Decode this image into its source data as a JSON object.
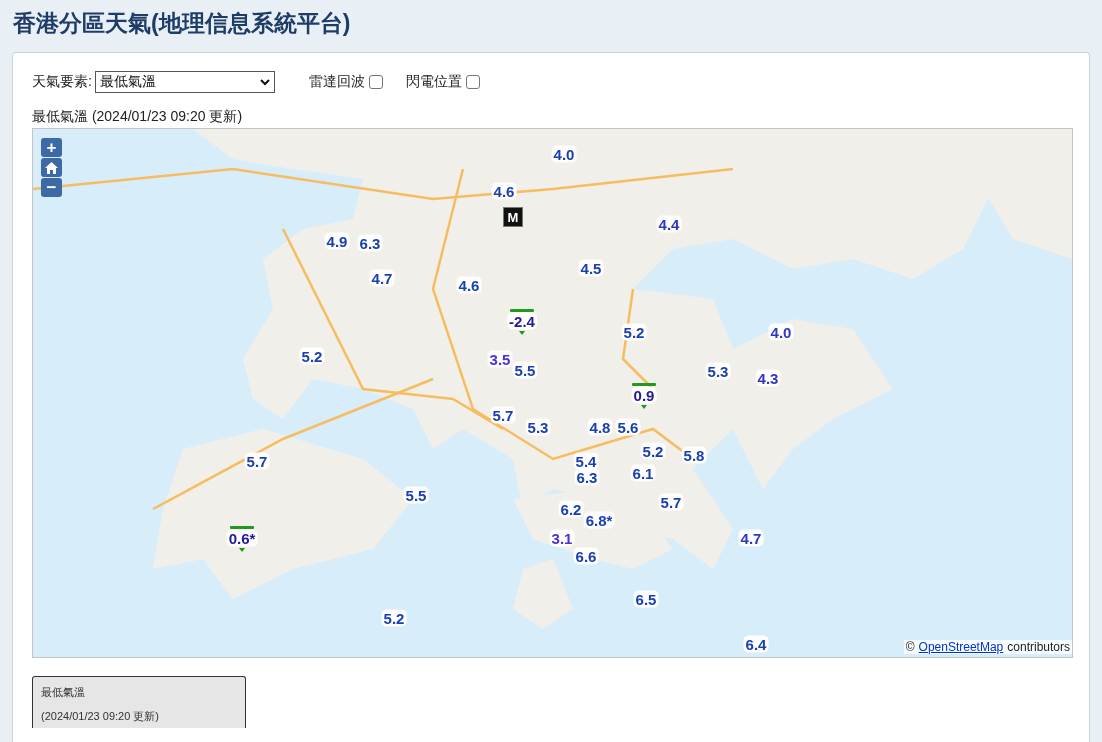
{
  "title": "香港分區天氣(地理信息系統平台)",
  "controls": {
    "element_label": "天氣要素:",
    "element_value": "最低氣溫",
    "checkboxes": [
      {
        "label": "雷達回波",
        "checked": false
      },
      {
        "label": "閃電位置",
        "checked": false
      }
    ]
  },
  "map_heading": "最低氣溫 (2024/01/23 09:20 更新)",
  "map": {
    "zoom_in": "+",
    "zoom_out": "−",
    "marker": "M",
    "stations": [
      {
        "value": "4.0",
        "color": "#1a3fb0",
        "lowest": false
      },
      {
        "value": "4.6",
        "color": "#1a3fb0",
        "lowest": false
      },
      {
        "value": "4.4",
        "color": "#2f35c4",
        "lowest": false
      },
      {
        "value": "4.9",
        "color": "#1a3fb0",
        "lowest": false
      },
      {
        "value": "6.3",
        "color": "#1a3fb0",
        "lowest": false
      },
      {
        "value": "4.7",
        "color": "#1a3fb0",
        "lowest": false
      },
      {
        "value": "4.6",
        "color": "#1a3fb0",
        "lowest": false
      },
      {
        "value": "4.5",
        "color": "#1a3fb0",
        "lowest": false
      },
      {
        "value": "-2.4",
        "color": "#23199a",
        "lowest": true
      },
      {
        "value": "5.2",
        "color": "#1a3fb0",
        "lowest": false
      },
      {
        "value": "4.0",
        "color": "#2f35c4",
        "lowest": false
      },
      {
        "value": "5.2",
        "color": "#1a3fb0",
        "lowest": false
      },
      {
        "value": "3.5",
        "color": "#4b2fd8",
        "lowest": false
      },
      {
        "value": "5.5",
        "color": "#1a3fb0",
        "lowest": false
      },
      {
        "value": "5.3",
        "color": "#1a3fb0",
        "lowest": false
      },
      {
        "value": "4.3",
        "color": "#2f35c4",
        "lowest": false
      },
      {
        "value": "0.9",
        "color": "#23199a",
        "lowest": true
      },
      {
        "value": "5.7",
        "color": "#1a3fb0",
        "lowest": false
      },
      {
        "value": "5.3",
        "color": "#1a3fb0",
        "lowest": false
      },
      {
        "value": "4.8",
        "color": "#1a3fb0",
        "lowest": false
      },
      {
        "value": "5.6",
        "color": "#1a3fb0",
        "lowest": false
      },
      {
        "value": "5.7",
        "color": "#1a3fb0",
        "lowest": false
      },
      {
        "value": "5.4",
        "color": "#1a3fb0",
        "lowest": false
      },
      {
        "value": "5.2",
        "color": "#1a3fb0",
        "lowest": false
      },
      {
        "value": "5.8",
        "color": "#1a3fb0",
        "lowest": false
      },
      {
        "value": "6.3",
        "color": "#1a3fb0",
        "lowest": false
      },
      {
        "value": "6.1",
        "color": "#1a3fb0",
        "lowest": false
      },
      {
        "value": "5.5",
        "color": "#1a3fb0",
        "lowest": false
      },
      {
        "value": "6.2",
        "color": "#1a3fb0",
        "lowest": false
      },
      {
        "value": "5.7",
        "color": "#1a3fb0",
        "lowest": false
      },
      {
        "value": "6.8*",
        "color": "#1a3fb0",
        "lowest": false
      },
      {
        "value": "0.6*",
        "color": "#23199a",
        "lowest": true
      },
      {
        "value": "3.1",
        "color": "#4b2fd8",
        "lowest": false
      },
      {
        "value": "4.7",
        "color": "#2f35c4",
        "lowest": false
      },
      {
        "value": "6.6",
        "color": "#1a3fb0",
        "lowest": false
      },
      {
        "value": "6.5",
        "color": "#1a3fb0",
        "lowest": false
      },
      {
        "value": "5.2",
        "color": "#1a3fb0",
        "lowest": false
      },
      {
        "value": "6.4",
        "color": "#1a3fb0",
        "lowest": false
      }
    ],
    "attribution": {
      "symbol": "©",
      "link": "OpenStreetMap",
      "text": "contributors"
    }
  },
  "legend": {
    "title": "最低氣溫",
    "updated": "(2024/01/23 09:20 更新)"
  }
}
